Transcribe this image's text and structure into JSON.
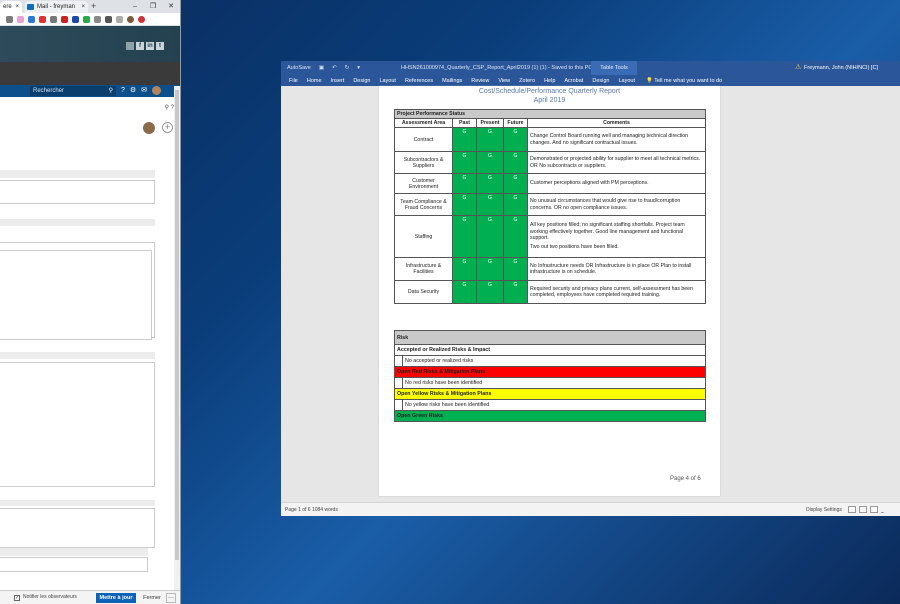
{
  "browser": {
    "tabs": [
      {
        "label": "ere"
      },
      {
        "label": "Mail - freyman"
      }
    ],
    "new_tab": "+",
    "window_controls": [
      "–",
      "❐",
      "✕"
    ],
    "social": [
      "f",
      "in",
      "t"
    ],
    "search_placeholder": "Rechercher",
    "help_icon": "?",
    "notify_label": "Notifier les observateurs",
    "update_button": "Mettre à jour",
    "close_button": "Fermer",
    "more_button": "···"
  },
  "word": {
    "autosave": "AutoSave",
    "doc_title": "HHSN261000974_Quarterly_CSP_Report_April2019 (1) (1) - Saved to this PC",
    "table_tools": "Table Tools",
    "user": "Freymann, John (NIH/NCI) [C]",
    "ribbon_tabs": [
      "File",
      "Home",
      "Insert",
      "Design",
      "Layout",
      "References",
      "Mailings",
      "Review",
      "View",
      "Zotero",
      "Help",
      "Acrobat",
      "Design",
      "Layout"
    ],
    "tell_me": "Tell me what you want to do",
    "status_left": "Page 1 of 6   1084 words",
    "display_settings": "Display Settings",
    "zoom_minus": "–"
  },
  "page": {
    "header1": "Cost/Schedule/Performance Quarterly Report",
    "header2": "April 2019",
    "page_number": "Page 4 of 6"
  },
  "performance": {
    "title": "Project Performance Status",
    "columns": [
      "Assessment Area",
      "Past",
      "Present",
      "Future",
      "Comments"
    ],
    "rows": [
      {
        "area": "Contract",
        "past": "G",
        "present": "G",
        "future": "G",
        "comment": "Change Control Board running well and managing technical direction changes. And no significant contractual issues."
      },
      {
        "area": "Subcontractors & Suppliers",
        "past": "G",
        "present": "G",
        "future": "G",
        "comment": "Demonstrated or projected ability for supplier to meet all technical metrics. OR No subcontracts or suppliers."
      },
      {
        "area": "Customer Environment",
        "past": "G",
        "present": "G",
        "future": "G",
        "comment": "Customer perceptions aligned with PM perceptions."
      },
      {
        "area": "Team Compliance & Fraud Concerns",
        "past": "G",
        "present": "G",
        "future": "G",
        "comment": "No unusual circumstances that would give rise to fraud/corruption concerns. OR no open compliance issues."
      },
      {
        "area": "Staffing",
        "past": "G",
        "present": "G",
        "future": "G",
        "comment": "All key positions filled; no significant staffing shortfalls. Project team working effectively together. Good line management and functional support.",
        "comment2": "Two out two positions have been filled."
      },
      {
        "area": "Infrastructure & Facilities",
        "past": "G",
        "present": "G",
        "future": "G",
        "comment": "No Infrastructure needs OR Infrastructure is in place OR Plan to install infrastructure is on schedule."
      },
      {
        "area": "Data Security",
        "past": "G",
        "present": "G",
        "future": "G",
        "comment": "Required security and privacy plans current, self-assessment has been completed, employees have completed required training."
      }
    ]
  },
  "risk": {
    "title": "Risk",
    "accepted_title": "Accepted or Realized Risks & Impact",
    "accepted_text": "No accepted or realized risks",
    "red_title": "Open Red Risks & Mitigation Plans",
    "red_text": "No red risks have been identified",
    "yellow_title": "Open Yellow Risks & Mitigation Plans",
    "yellow_text": "No yellow risks have been identified",
    "green_title": "Open Green Risks"
  },
  "colors": {
    "green": "#00b050",
    "red": "#ff0000",
    "yellow": "#ffff00",
    "word_blue": "#2b579a"
  }
}
